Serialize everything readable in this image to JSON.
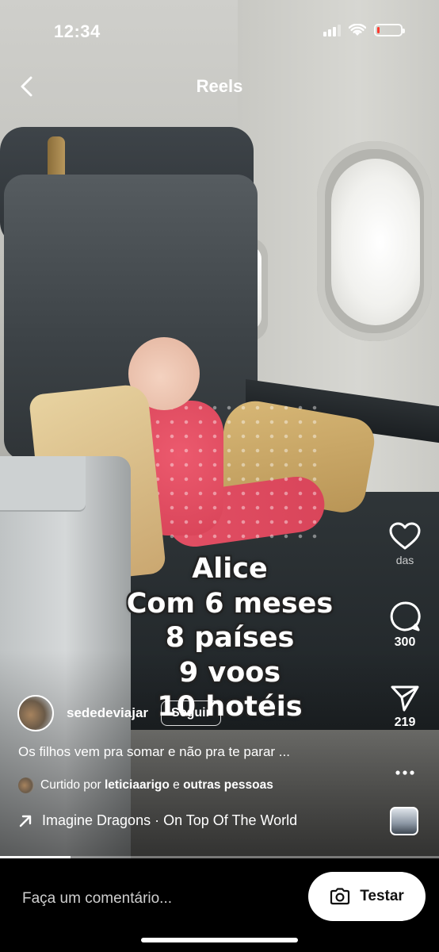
{
  "status_bar": {
    "time": "12:34",
    "battery_color": "#ff3b30",
    "battery_level": 0.1,
    "icons": [
      "signal-icon",
      "wifi-icon",
      "battery-icon"
    ]
  },
  "header": {
    "title": "Reels",
    "back_icon": "chevron-left-icon"
  },
  "caption_lines": [
    "Alice",
    "Com 6 meses",
    "8 países",
    "9 voos",
    "10 hotéis"
  ],
  "actions": {
    "like_label": "das",
    "comments_count": "300",
    "shares_count": "219",
    "icons": [
      "heart-icon",
      "comment-icon",
      "send-icon",
      "more-icon"
    ]
  },
  "post": {
    "username": "sededeviajar",
    "follow_label": "Seguir",
    "description": "Os filhos vem pra somar e não pra te parar ...",
    "liked_prefix": "Curtido por",
    "liked_user": "leticiaarigo",
    "liked_joiner": "e",
    "liked_suffix": "outras pessoas",
    "music": "Imagine Dragons · On Top Of The World"
  },
  "progress": 0.16,
  "comment_bar": {
    "placeholder": "Faça um comentário...",
    "try_label": "Testar"
  }
}
